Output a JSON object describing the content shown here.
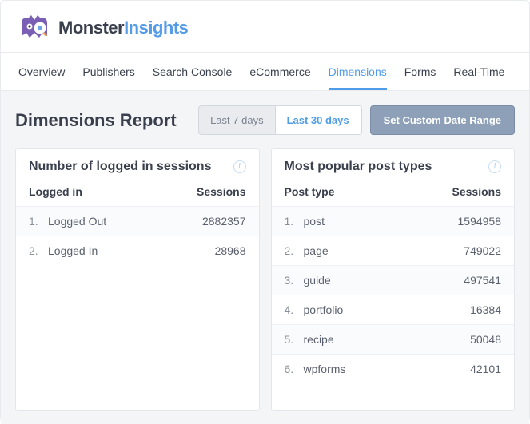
{
  "brand": {
    "name1": "Monster",
    "name2": "Insights"
  },
  "tabs": [
    {
      "label": "Overview",
      "active": false
    },
    {
      "label": "Publishers",
      "active": false
    },
    {
      "label": "Search Console",
      "active": false
    },
    {
      "label": "eCommerce",
      "active": false
    },
    {
      "label": "Dimensions",
      "active": true
    },
    {
      "label": "Forms",
      "active": false
    },
    {
      "label": "Real-Time",
      "active": false
    }
  ],
  "page_title": "Dimensions Report",
  "date_ranges": {
    "last7": "Last 7 days",
    "last30": "Last 30 days",
    "custom": "Set Custom Date Range",
    "active": "last30"
  },
  "panel_left": {
    "title": "Number of logged in sessions",
    "col1": "Logged in",
    "col2": "Sessions",
    "rows": [
      {
        "label": "Logged Out",
        "value": "2882357"
      },
      {
        "label": "Logged In",
        "value": "28968"
      }
    ]
  },
  "panel_right": {
    "title": "Most popular post types",
    "col1": "Post type",
    "col2": "Sessions",
    "rows": [
      {
        "label": "post",
        "value": "1594958"
      },
      {
        "label": "page",
        "value": "749022"
      },
      {
        "label": "guide",
        "value": "497541"
      },
      {
        "label": "portfolio",
        "value": "16384"
      },
      {
        "label": "recipe",
        "value": "50048"
      },
      {
        "label": "wpforms",
        "value": "42101"
      }
    ]
  }
}
